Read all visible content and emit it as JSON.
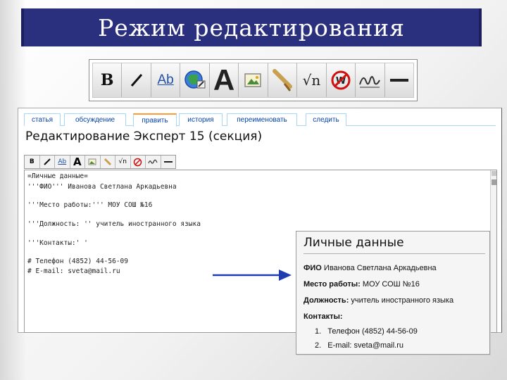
{
  "slide": {
    "title": "Режим редактирования"
  },
  "big_toolbar": {
    "buttons": [
      {
        "icon": "bold-icon",
        "label": "B"
      },
      {
        "icon": "italic-icon"
      },
      {
        "icon": "internal-link-icon",
        "label": "Ab"
      },
      {
        "icon": "external-link-icon"
      },
      {
        "icon": "heading-icon",
        "label": "A"
      },
      {
        "icon": "embedded-image-icon"
      },
      {
        "icon": "media-file-icon"
      },
      {
        "icon": "math-formula-icon",
        "label": "√n"
      },
      {
        "icon": "nowiki-icon"
      },
      {
        "icon": "signature-icon"
      },
      {
        "icon": "horizontal-line-icon"
      }
    ]
  },
  "wiki": {
    "tabs": [
      {
        "label": "статья"
      },
      {
        "label": "обсуждение"
      },
      {
        "label": "править"
      },
      {
        "label": "история"
      },
      {
        "label": "переименовать"
      },
      {
        "label": "следить"
      }
    ],
    "page_heading": "Редактирование Эксперт 15 (секция)",
    "small_toolbar": {
      "labels": [
        "B",
        "",
        "Ab",
        "A",
        "",
        "",
        "√n",
        "",
        "",
        ""
      ]
    },
    "editor_lines": [
      "=Личные данные=",
      "'''ФИО''' Иванова Светлана Аркадьевна",
      "'''Место работы:''' МОУ СОШ №16",
      "'''Должность: '' учитель иностранного языка",
      "'''Контакты:' '",
      "# Телефон (4852) 44-56-09",
      "# E-mail: sveta@mail.ru"
    ]
  },
  "preview": {
    "title": "Личные данные",
    "fio_label": "ФИО",
    "fio_value": "Иванова Светлана Аркадьевна",
    "work_label": "Место работы:",
    "work_value": "МОУ СОШ №16",
    "position_label": "Должность:",
    "position_value": "учитель иностранного языка",
    "contacts_label": "Контакты:",
    "contacts": [
      {
        "num": "1.",
        "text": "Телефон (4852) 44-56-09"
      },
      {
        "num": "2.",
        "text": "E-mail: sveta@mail.ru"
      }
    ]
  },
  "colors": {
    "title_bar": "#2a2f7e",
    "tab_border": "#a7d7f9",
    "tab_active_accent": "#ff9b34",
    "link_blue": "#0645ad",
    "arrow_blue": "#1f3bb0"
  }
}
